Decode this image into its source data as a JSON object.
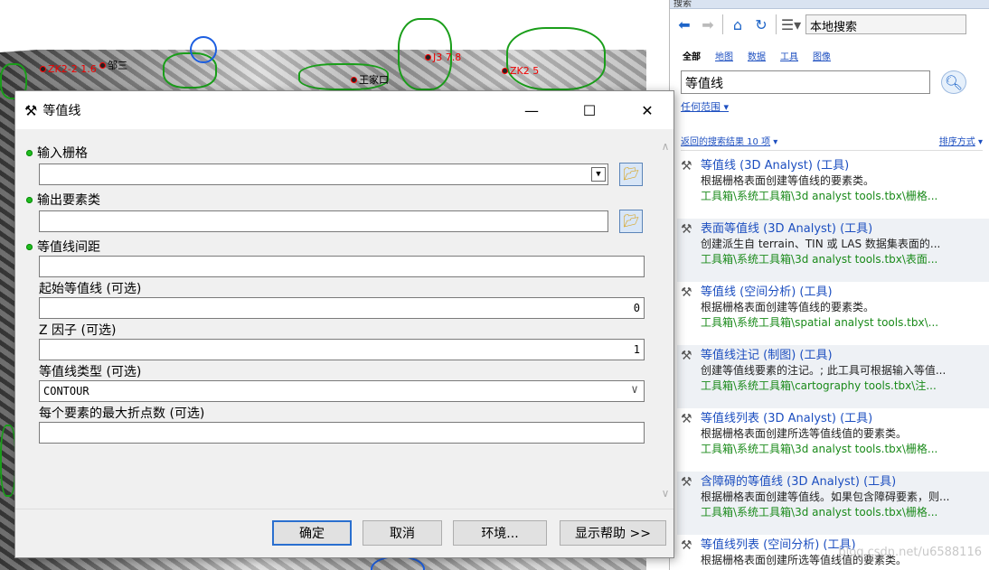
{
  "map": {
    "labels": [
      {
        "text": "ZK2-2 1.6",
        "red": true
      },
      {
        "text": "邹三",
        "red": false
      },
      {
        "text": "王家口",
        "red": false
      },
      {
        "text": "J3 7.8",
        "red": true
      },
      {
        "text": "ZK2 5",
        "red": true
      }
    ]
  },
  "dialog": {
    "title": "等值线",
    "minimize": "—",
    "maximize": "☐",
    "close": "✕",
    "fields": {
      "input_raster": {
        "label": "输入栅格",
        "value": ""
      },
      "output_features": {
        "label": "输出要素类",
        "value": ""
      },
      "contour_interval": {
        "label": "等值线间距",
        "value": ""
      },
      "base_contour": {
        "label": "起始等值线 (可选)",
        "value": "0"
      },
      "z_factor": {
        "label": "Z 因子 (可选)",
        "value": "1"
      },
      "contour_type": {
        "label": "等值线类型 (可选)",
        "value": "CONTOUR"
      },
      "max_vertices": {
        "label": "每个要素的最大折点数 (可选)",
        "value": ""
      }
    },
    "buttons": {
      "ok": "确定",
      "cancel": "取消",
      "environments": "环境...",
      "show_help": "显示帮助 >>"
    }
  },
  "search": {
    "pane_title": "搜索",
    "scope": "本地搜索",
    "filters": [
      {
        "label": "全部",
        "active": true
      },
      {
        "label": "地图",
        "active": false
      },
      {
        "label": "数据",
        "active": false
      },
      {
        "label": "工具",
        "active": false
      },
      {
        "label": "图像",
        "active": false
      }
    ],
    "query": "等值线",
    "any_scope": "任何范围",
    "result_count": "返回的搜索结果 10 项",
    "sort": "排序方式",
    "results": [
      {
        "title": "等值线 (3D Analyst) (工具)",
        "desc": "根据栅格表面创建等值线的要素类。",
        "path": "工具箱\\系统工具箱\\3d analyst tools.tbx\\栅格..."
      },
      {
        "title": "表面等值线 (3D Analyst) (工具)",
        "desc": "创建派生自 terrain、TIN 或 LAS 数据集表面的...",
        "path": "工具箱\\系统工具箱\\3d analyst tools.tbx\\表面..."
      },
      {
        "title": "等值线 (空间分析) (工具)",
        "desc": "根据栅格表面创建等值线的要素类。",
        "path": "工具箱\\系统工具箱\\spatial analyst tools.tbx\\..."
      },
      {
        "title": "等值线注记 (制图) (工具)",
        "desc": "创建等值线要素的注记。; 此工具可根据输入等值...",
        "path": "工具箱\\系统工具箱\\cartography tools.tbx\\注..."
      },
      {
        "title": "等值线列表 (3D Analyst) (工具)",
        "desc": "根据栅格表面创建所选等值线值的要素类。",
        "path": "工具箱\\系统工具箱\\3d analyst tools.tbx\\栅格..."
      },
      {
        "title": "含障碍的等值线 (3D Analyst) (工具)",
        "desc": "根据栅格表面创建等值线。如果包含障碍要素，则...",
        "path": "工具箱\\系统工具箱\\3d analyst tools.tbx\\栅格..."
      },
      {
        "title": "等值线列表 (空间分析) (工具)",
        "desc": "根据栅格表面创建所选等值线值的要素类。",
        "path": ""
      }
    ],
    "watermark": "blog.csdn.net/u6588116"
  }
}
